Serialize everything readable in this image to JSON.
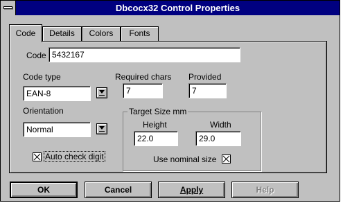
{
  "window": {
    "title": "Dbcocx32 Control Properties"
  },
  "tabs": [
    {
      "label": "Code",
      "active": true
    },
    {
      "label": "Details"
    },
    {
      "label": "Colors"
    },
    {
      "label": "Fonts"
    }
  ],
  "code": {
    "label": "Code",
    "value": "5432167"
  },
  "code_type": {
    "label": "Code type",
    "value": "EAN-8"
  },
  "required_chars": {
    "label": "Required chars",
    "value": "7"
  },
  "provided": {
    "label": "Provided",
    "value": "7"
  },
  "orientation": {
    "label": "Orientation",
    "value": "Normal"
  },
  "target_size": {
    "title": "Target Size mm",
    "height_label": "Height",
    "height_value": "22.0",
    "width_label": "Width",
    "width_value": "29.0",
    "nominal_label": "Use nominal size",
    "nominal_checked": true
  },
  "auto_check": {
    "label": "Auto check digit",
    "checked": true
  },
  "buttons": {
    "ok": "OK",
    "cancel": "Cancel",
    "apply": "Apply",
    "help": "Help"
  }
}
